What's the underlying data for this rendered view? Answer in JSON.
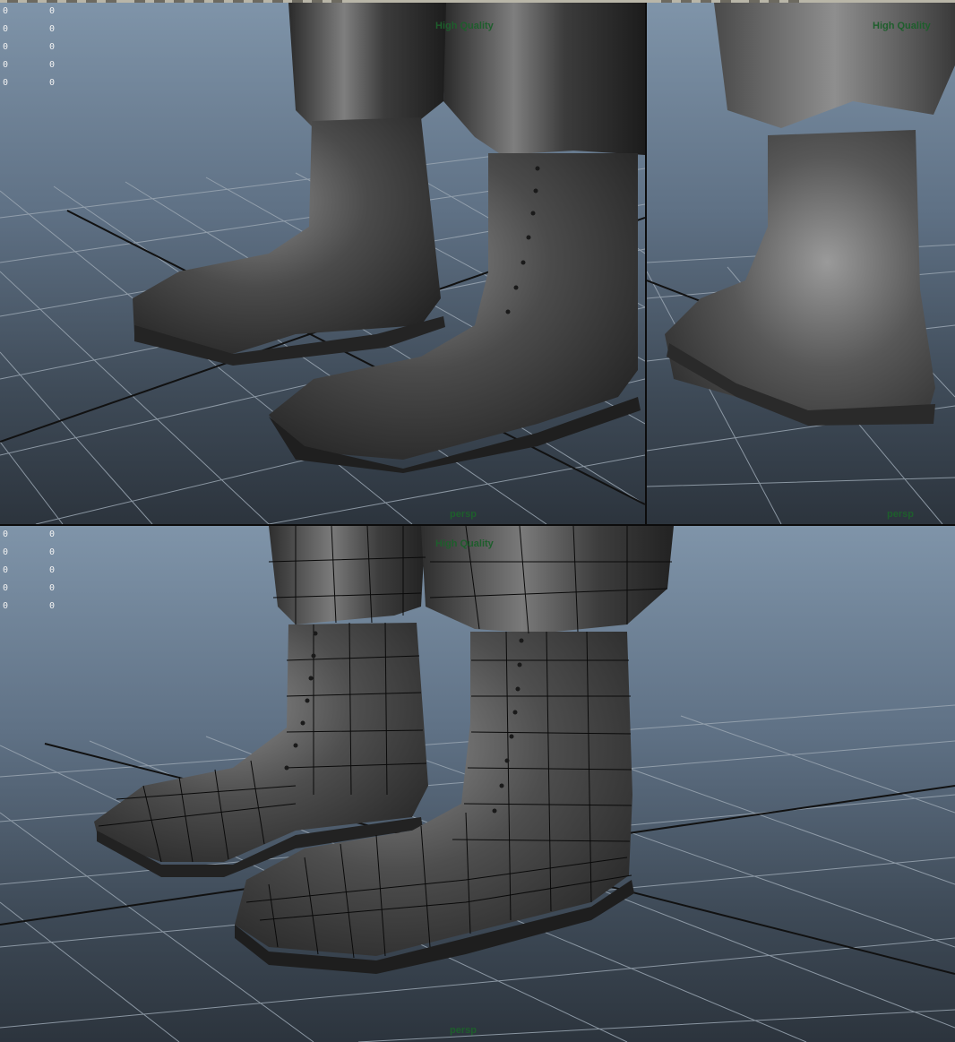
{
  "viewports": {
    "top_left": {
      "label_quality": "High Quality",
      "label_camera": "persp",
      "stats": [
        [
          "0",
          "0"
        ],
        [
          "0",
          "0"
        ],
        [
          "0",
          "0"
        ],
        [
          "0",
          "0"
        ],
        [
          "0",
          "0"
        ]
      ]
    },
    "top_right": {
      "label_quality": "High Quality",
      "label_camera": "persp"
    },
    "bottom": {
      "label_quality": "High Quality",
      "label_camera": "persp",
      "stats": [
        [
          "0",
          "0"
        ],
        [
          "0",
          "0"
        ],
        [
          "0",
          "0"
        ],
        [
          "0",
          "0"
        ],
        [
          "0",
          "0"
        ]
      ]
    }
  },
  "colors": {
    "hud_label": "#1e5e2c",
    "grid": "#9aa6b2",
    "grid_axis": "#111111",
    "model_dark": "#2a2a2a",
    "model_light": "#8a8a8a",
    "wire": "#0a0a0a"
  },
  "model": {
    "object": "boots-and-trousers",
    "shading_top": "smooth-shaded",
    "shading_bottom": "wireframe-on-shaded"
  }
}
